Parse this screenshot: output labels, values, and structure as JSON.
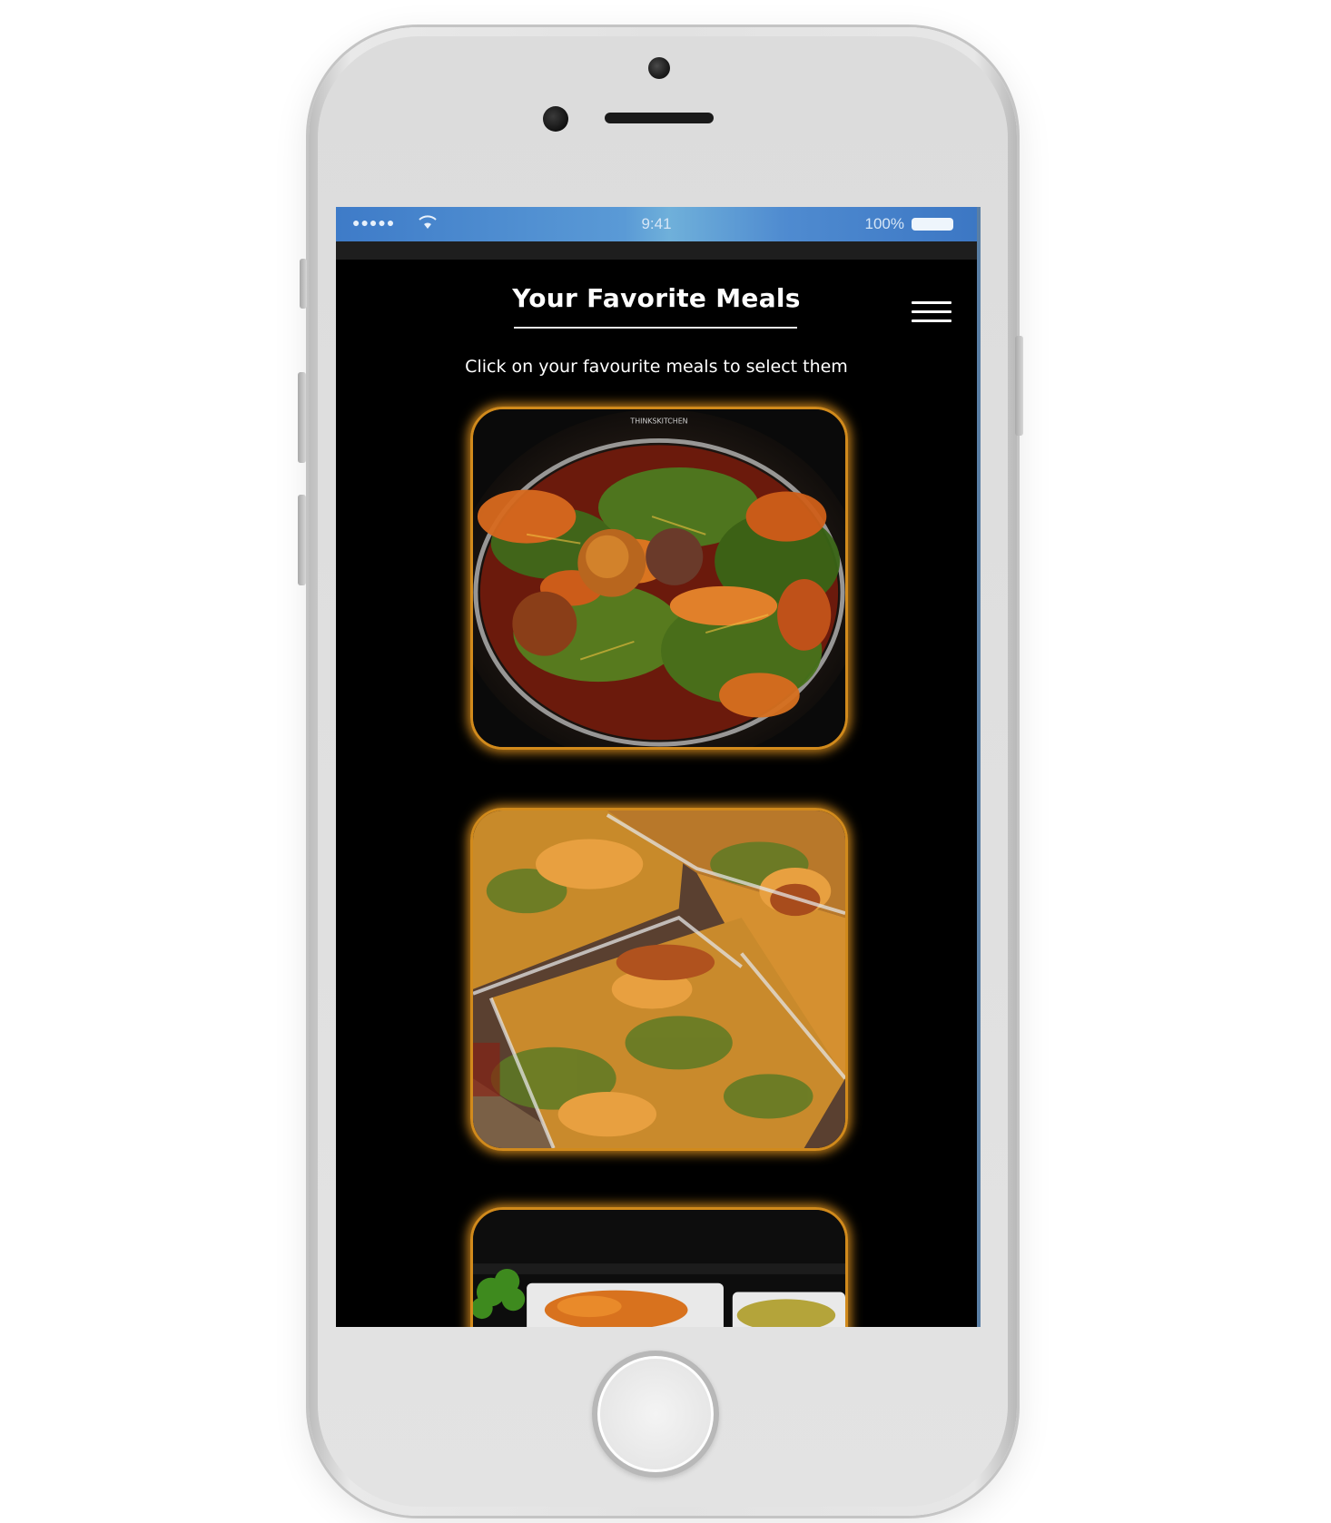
{
  "status_bar": {
    "signal": "●●●●●",
    "time": "9:41",
    "battery": "100%"
  },
  "header": {
    "title": "Your Favorite Meals",
    "menu_icon": "hamburger-menu-icon"
  },
  "instruction": "Click on your favourite meals to select them",
  "meals": [
    {
      "photo": "vegetable-soup-pot-photo",
      "watermark": "THINKSKITCHEN"
    },
    {
      "photo": "soup-takeaway-trays-photo"
    },
    {
      "photo": "food-trays-garnish-photo"
    }
  ],
  "colors": {
    "screen_background": "#000000",
    "card_glow": "#d18a1c",
    "status_bar": "#4a8ad0",
    "phone_body": "#e2e2e2"
  }
}
